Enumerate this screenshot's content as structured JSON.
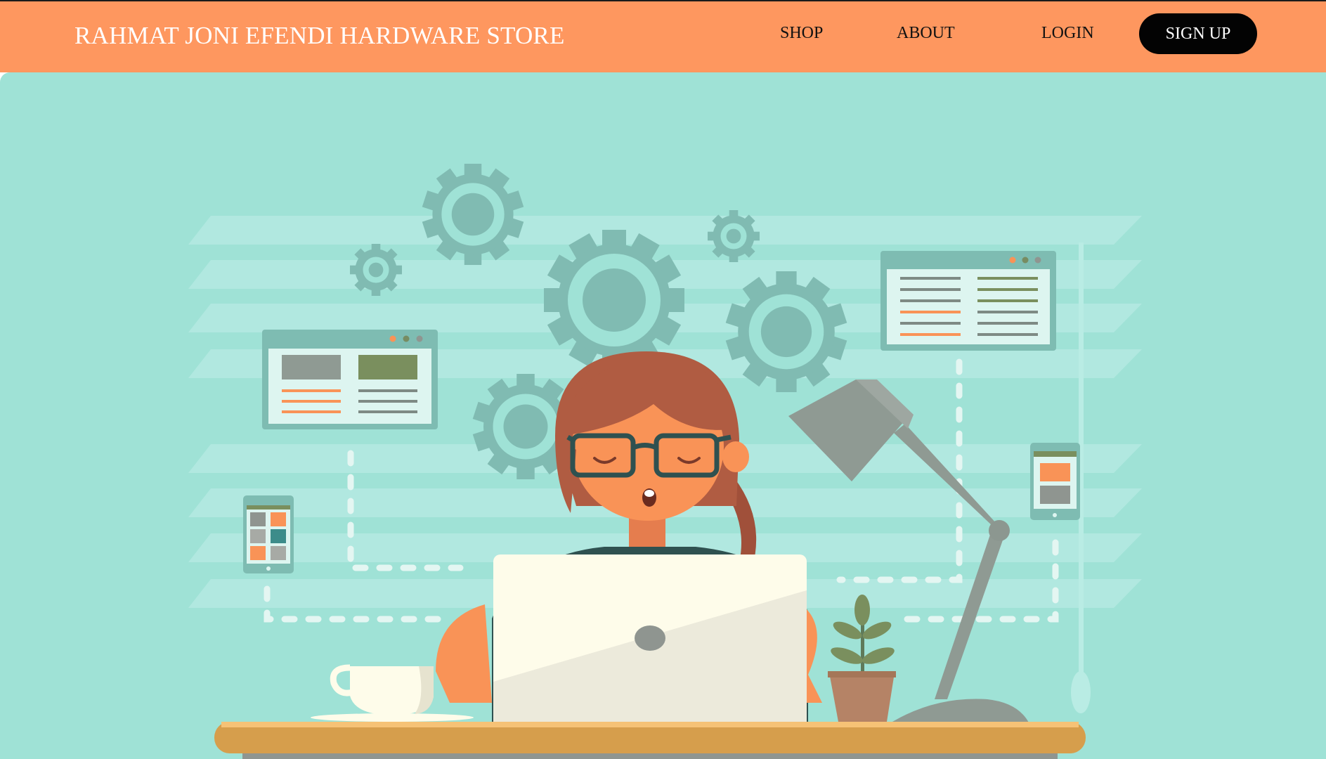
{
  "header": {
    "brand": "RAHMAT JONI EFENDI HARDWARE STORE",
    "nav": {
      "shop": "SHOP",
      "about": "ABOUT",
      "login": "LOGIN",
      "signup": "SIGN UP"
    }
  },
  "hero": {
    "illustration": "woman-at-laptop-illustration",
    "icons": [
      "gear-icon",
      "browser-window-icon",
      "tablet-icon",
      "phone-icon",
      "desk-lamp-icon",
      "coffee-cup-icon",
      "potted-plant-icon"
    ]
  },
  "colors": {
    "header_bg": "#fe975f",
    "hero_bg": "#9fe2d6",
    "signup_bg": "#030303",
    "gear": "#80bbb2",
    "accent_orange": "#f99357",
    "desk": "#d69e4c"
  }
}
